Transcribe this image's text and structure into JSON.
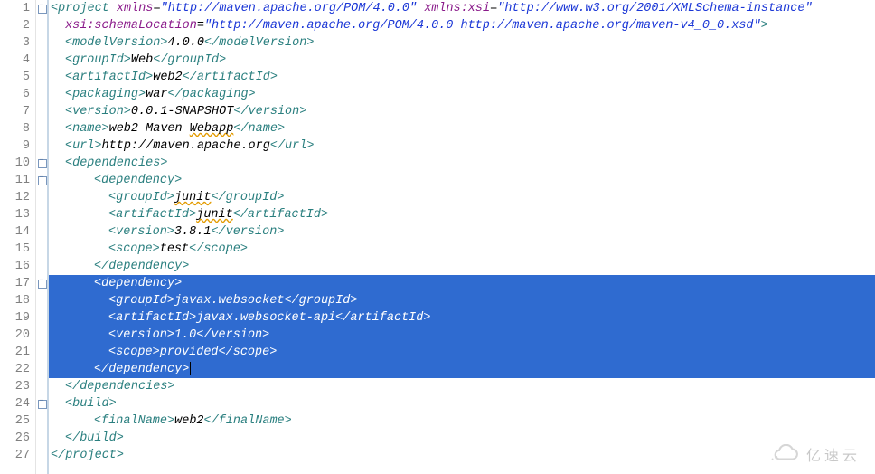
{
  "line_count": 27,
  "fold_lines": [
    1,
    10,
    11,
    17,
    24
  ],
  "selection": {
    "start": 17,
    "end": 22
  },
  "watermark": "亿速云",
  "code": [
    {
      "n": 1,
      "indent": 0,
      "sel": false,
      "runs": [
        {
          "c": "tag",
          "t": "<project"
        },
        {
          "c": "txt",
          "t": " "
        },
        {
          "c": "attr",
          "t": "xmlns"
        },
        {
          "c": "txt",
          "t": "="
        },
        {
          "c": "str",
          "t": "\"http://maven.apache.org/POM/4.0.0\""
        },
        {
          "c": "txt",
          "t": " "
        },
        {
          "c": "attr",
          "t": "xmlns:xsi"
        },
        {
          "c": "txt",
          "t": "="
        },
        {
          "c": "str",
          "t": "\"http://www.w3.org/2001/XMLSchema-instance\""
        }
      ]
    },
    {
      "n": 2,
      "indent": 2,
      "sel": false,
      "runs": [
        {
          "c": "attr",
          "t": "xsi:schemaLocation"
        },
        {
          "c": "txt",
          "t": "="
        },
        {
          "c": "str",
          "t": "\"http://maven.apache.org/POM/4.0.0 http://maven.apache.org/maven-v4_0_0.xsd\""
        },
        {
          "c": "tag",
          "t": ">"
        }
      ]
    },
    {
      "n": 3,
      "indent": 2,
      "sel": false,
      "runs": [
        {
          "c": "tag",
          "t": "<modelVersion>"
        },
        {
          "c": "txt",
          "t": "4.0.0"
        },
        {
          "c": "tag",
          "t": "</modelVersion>"
        }
      ]
    },
    {
      "n": 4,
      "indent": 2,
      "sel": false,
      "runs": [
        {
          "c": "tag",
          "t": "<groupId>"
        },
        {
          "c": "txt",
          "t": "Web"
        },
        {
          "c": "tag",
          "t": "</groupId>"
        }
      ]
    },
    {
      "n": 5,
      "indent": 2,
      "sel": false,
      "runs": [
        {
          "c": "tag",
          "t": "<artifactId>"
        },
        {
          "c": "txt",
          "t": "web2"
        },
        {
          "c": "tag",
          "t": "</artifactId>"
        }
      ]
    },
    {
      "n": 6,
      "indent": 2,
      "sel": false,
      "runs": [
        {
          "c": "tag",
          "t": "<packaging>"
        },
        {
          "c": "txt",
          "t": "war"
        },
        {
          "c": "tag",
          "t": "</packaging>"
        }
      ]
    },
    {
      "n": 7,
      "indent": 2,
      "sel": false,
      "runs": [
        {
          "c": "tag",
          "t": "<version>"
        },
        {
          "c": "txt",
          "t": "0.0.1-SNAPSHOT"
        },
        {
          "c": "tag",
          "t": "</version>"
        }
      ]
    },
    {
      "n": 8,
      "indent": 2,
      "sel": false,
      "runs": [
        {
          "c": "tag",
          "t": "<name>"
        },
        {
          "c": "txt",
          "t": "web2 Maven "
        },
        {
          "c": "txt",
          "t": "Webapp",
          "sq": true
        },
        {
          "c": "tag",
          "t": "</name>"
        }
      ]
    },
    {
      "n": 9,
      "indent": 2,
      "sel": false,
      "runs": [
        {
          "c": "tag",
          "t": "<url>"
        },
        {
          "c": "txt",
          "t": "http://maven.apache.org"
        },
        {
          "c": "tag",
          "t": "</url>"
        }
      ]
    },
    {
      "n": 10,
      "indent": 2,
      "sel": false,
      "runs": [
        {
          "c": "tag",
          "t": "<dependencies>"
        }
      ]
    },
    {
      "n": 11,
      "indent": 4,
      "sel": false,
      "runs": [
        {
          "c": "tag",
          "t": "<dependency>"
        }
      ]
    },
    {
      "n": 12,
      "indent": 5,
      "sel": false,
      "runs": [
        {
          "c": "tag",
          "t": "<groupId>"
        },
        {
          "c": "txt",
          "t": "junit",
          "sq": true
        },
        {
          "c": "tag",
          "t": "</groupId>"
        }
      ]
    },
    {
      "n": 13,
      "indent": 5,
      "sel": false,
      "runs": [
        {
          "c": "tag",
          "t": "<artifactId>"
        },
        {
          "c": "txt",
          "t": "junit",
          "sq": true
        },
        {
          "c": "tag",
          "t": "</artifactId>"
        }
      ]
    },
    {
      "n": 14,
      "indent": 5,
      "sel": false,
      "runs": [
        {
          "c": "tag",
          "t": "<version>"
        },
        {
          "c": "txt",
          "t": "3.8.1"
        },
        {
          "c": "tag",
          "t": "</version>"
        }
      ]
    },
    {
      "n": 15,
      "indent": 5,
      "sel": false,
      "runs": [
        {
          "c": "tag",
          "t": "<scope>"
        },
        {
          "c": "txt",
          "t": "test"
        },
        {
          "c": "tag",
          "t": "</scope>"
        }
      ]
    },
    {
      "n": 16,
      "indent": 4,
      "sel": false,
      "runs": [
        {
          "c": "tag",
          "t": "</dependency>"
        }
      ]
    },
    {
      "n": 17,
      "indent": 4,
      "sel": true,
      "runs": [
        {
          "c": "tag",
          "t": "<dependency>"
        }
      ]
    },
    {
      "n": 18,
      "indent": 5,
      "sel": true,
      "runs": [
        {
          "c": "tag",
          "t": "<groupId>"
        },
        {
          "c": "txt",
          "t": "javax.websocket"
        },
        {
          "c": "tag",
          "t": "</groupId>"
        }
      ]
    },
    {
      "n": 19,
      "indent": 5,
      "sel": true,
      "runs": [
        {
          "c": "tag",
          "t": "<artifactId>"
        },
        {
          "c": "txt",
          "t": "javax.websocket-api"
        },
        {
          "c": "tag",
          "t": "</artifactId>"
        }
      ]
    },
    {
      "n": 20,
      "indent": 5,
      "sel": true,
      "runs": [
        {
          "c": "tag",
          "t": "<version>"
        },
        {
          "c": "txt",
          "t": "1.0"
        },
        {
          "c": "tag",
          "t": "</version>"
        }
      ]
    },
    {
      "n": 21,
      "indent": 5,
      "sel": true,
      "runs": [
        {
          "c": "tag",
          "t": "<scope>"
        },
        {
          "c": "txt",
          "t": "provided"
        },
        {
          "c": "tag",
          "t": "</scope>"
        }
      ]
    },
    {
      "n": 22,
      "indent": 4,
      "sel": true,
      "cursor": true,
      "runs": [
        {
          "c": "tag",
          "t": "</dependency>"
        }
      ]
    },
    {
      "n": 23,
      "indent": 2,
      "sel": false,
      "runs": [
        {
          "c": "tag",
          "t": "</dependencies>"
        }
      ]
    },
    {
      "n": 24,
      "indent": 2,
      "sel": false,
      "runs": [
        {
          "c": "tag",
          "t": "<build>"
        }
      ]
    },
    {
      "n": 25,
      "indent": 4,
      "sel": false,
      "runs": [
        {
          "c": "tag",
          "t": "<finalName>"
        },
        {
          "c": "txt",
          "t": "web2"
        },
        {
          "c": "tag",
          "t": "</finalName>"
        }
      ]
    },
    {
      "n": 26,
      "indent": 2,
      "sel": false,
      "runs": [
        {
          "c": "tag",
          "t": "</build>"
        }
      ]
    },
    {
      "n": 27,
      "indent": 0,
      "sel": false,
      "runs": [
        {
          "c": "tag",
          "t": "</project>"
        }
      ]
    }
  ]
}
